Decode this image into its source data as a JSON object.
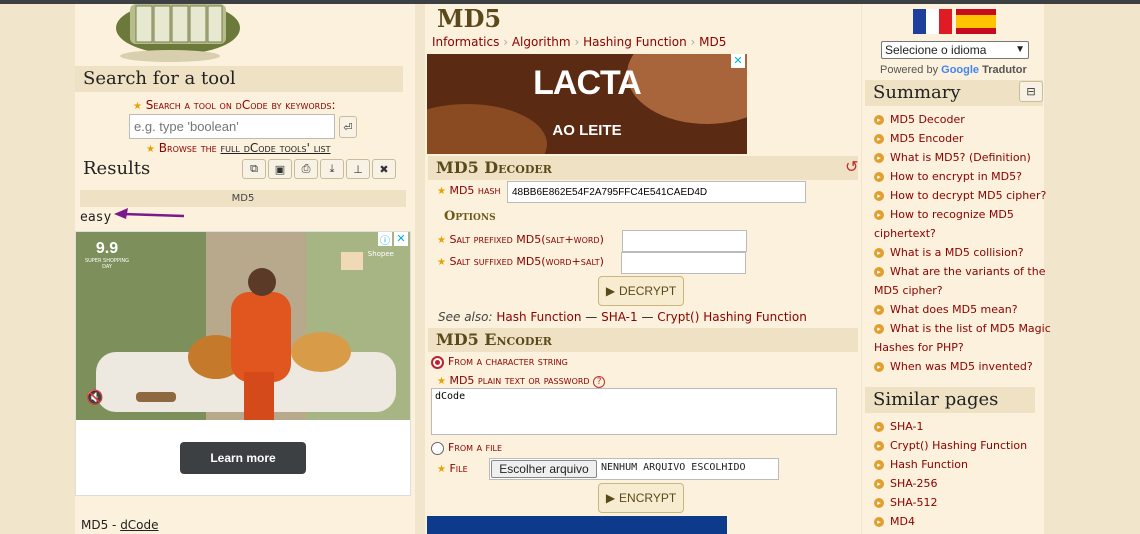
{
  "left": {
    "search_title": "Search for a tool",
    "search_prompt": "Search a tool on dCode by keywords:",
    "search_placeholder": "e.g. type 'boolean'",
    "browse_prefix": "Browse the ",
    "browse_link": "full dCode tools' list",
    "results_title": "Results",
    "results_header": "MD5",
    "result_value": "easy",
    "ad_learn_more": "Learn more",
    "ad_brand": "Shopee",
    "ad_badge_big": "9.9",
    "ad_badge_small": "SUPER SHOPPING DAY",
    "footer_text": "MD5 - ",
    "footer_link": "dCode"
  },
  "main": {
    "title": "MD5",
    "breadcrumb": [
      "Informatics",
      "Algorithm",
      "Hashing Function",
      "MD5"
    ],
    "ad_brand": "LACTA",
    "ad_sub": "AO LEITE",
    "decoder": {
      "title": "MD5 Decoder",
      "hash_label": "MD5 hash",
      "hash_value": "48BB6E862E54F2A795FFC4E541CAED4D",
      "options_title": "Options",
      "salt_prefixed_label": "Salt prefixed MD5(salt+word)",
      "salt_suffixed_label": "Salt suffixed MD5(word+salt)",
      "decrypt_label": "DECRYPT",
      "see_also_prefix": "See also: ",
      "see_also_links": [
        "Hash Function",
        "SHA-1",
        "Crypt() Hashing Function"
      ]
    },
    "encoder": {
      "title": "MD5 Encoder",
      "from_string_label": "From a character string",
      "plain_label": "MD5 plain text or password",
      "plain_value": "dCode",
      "from_file_label": "From a file",
      "file_label": "File",
      "choose_file_button": "Escolher arquivo",
      "no_file_text": "NENHUM ARQUIVO ESCOLHIDO",
      "encrypt_label": "ENCRYPT"
    }
  },
  "right": {
    "language_select": "Selecione o idioma",
    "powered_by": "Powered by",
    "google": "Google",
    "translator": "Tradutor",
    "summary_title": "Summary",
    "summary_items": [
      "MD5 Decoder",
      "MD5 Encoder",
      "What is MD5? (Definition)",
      "How to encrypt in MD5?",
      "How to decrypt MD5 cipher?",
      "How to recognize MD5",
      "ciphertext?",
      "What is a MD5 collision?",
      "What are the variants of the",
      "MD5 cipher?",
      "What does MD5 mean?",
      "What is the list of MD5 Magic",
      "Hashes for PHP?",
      "When was MD5 invented?"
    ],
    "similar_title": "Similar pages",
    "similar_items": [
      "SHA-1",
      "Crypt() Hashing Function",
      "Hash Function",
      "SHA-256",
      "SHA-512",
      "MD4"
    ]
  },
  "colors": {
    "link": "#8b0000",
    "panel": "#fbf1dc",
    "header": "#efe2c4",
    "arrow": "#7a1a8a"
  }
}
